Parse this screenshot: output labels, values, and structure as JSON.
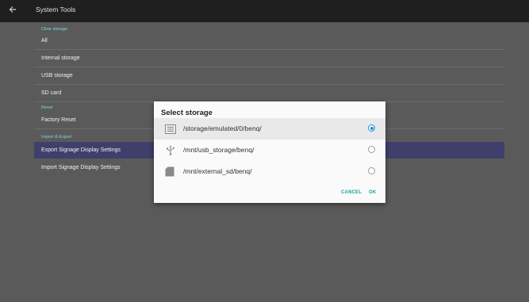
{
  "header": {
    "title": "System Tools",
    "back_icon": "arrow-left-icon"
  },
  "sections": {
    "clear_storage": "Clear storage",
    "reset": "Reset",
    "import_export": "Import & Export"
  },
  "rows": {
    "all": "All",
    "internal": "Internal storage",
    "usb": "USB storage",
    "sd": "SD card",
    "factory_reset": "Factory Reset",
    "export": "Export Signage Display Settings",
    "import": "Import Signage Display Settings"
  },
  "dialog": {
    "title": "Select storage",
    "options": [
      {
        "path": "/storage/emulated/0/benq/",
        "icon": "internal-storage-icon",
        "selected": true
      },
      {
        "path": "/mnt/usb_storage/benq/",
        "icon": "usb-icon",
        "selected": false
      },
      {
        "path": "/mnt/external_sd/benq/",
        "icon": "sd-card-icon",
        "selected": false
      }
    ],
    "cancel": "CANCEL",
    "ok": "OK"
  },
  "colors": {
    "accent": "#1aa3a3",
    "radio": "#1a8cd8",
    "selected_row": "#3e3f6b",
    "topbar": "#1f1f1f"
  }
}
